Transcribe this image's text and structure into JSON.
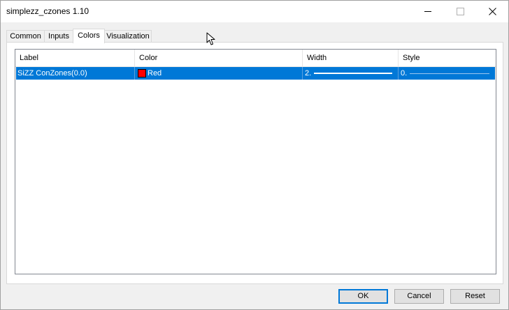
{
  "window": {
    "title": "simplezz_czones 1.10"
  },
  "tabs": [
    {
      "label": "Common"
    },
    {
      "label": "Inputs"
    },
    {
      "label": "Colors"
    },
    {
      "label": "Visualization"
    }
  ],
  "active_tab": "Colors",
  "table": {
    "columns": [
      "Label",
      "Color",
      "Width",
      "Style"
    ],
    "rows": [
      {
        "label": "SiZZ ConZones(0.0)",
        "color_name": "Red",
        "color_hex": "#ff0000",
        "width": "2.",
        "style": "0."
      }
    ]
  },
  "buttons": {
    "ok": "OK",
    "cancel": "Cancel",
    "reset": "Reset"
  },
  "colors": {
    "selection": "#0078d7",
    "default_button_border": "#0078d7"
  },
  "icons": {
    "minimize": "minimize-icon",
    "maximize": "maximize-icon",
    "close": "close-icon",
    "cursor": "mouse-cursor-icon"
  }
}
